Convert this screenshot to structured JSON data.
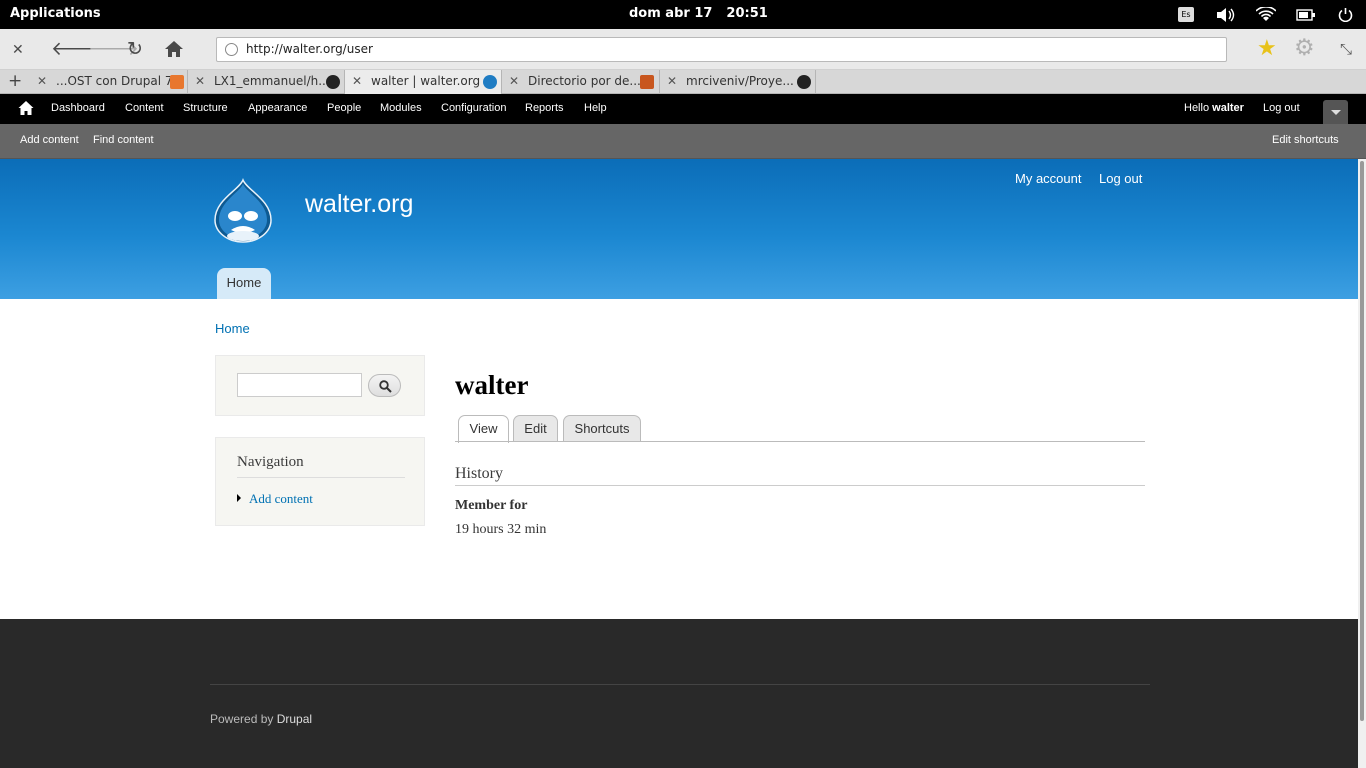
{
  "system": {
    "apps_label": "Applications",
    "date": "dom abr 17",
    "time": "20:51",
    "kbd_layout": "Es"
  },
  "browser": {
    "url": "http://walter.org/user",
    "tabs": [
      {
        "label": "...OST con Drupal 7",
        "favicon": "mozilla-icon"
      },
      {
        "label": "LX1_emmanuel/h...",
        "favicon": "github-icon"
      },
      {
        "label": "walter | walter.org",
        "favicon": "drupal-icon",
        "active": true
      },
      {
        "label": "Directorio por de...",
        "favicon": "folder-icon"
      },
      {
        "label": "mrciveniv/Proye...",
        "favicon": "github-icon"
      }
    ]
  },
  "admin": {
    "menu": [
      "Dashboard",
      "Content",
      "Structure",
      "Appearance",
      "People",
      "Modules",
      "Configuration",
      "Reports",
      "Help"
    ],
    "hello": "Hello",
    "user": "walter",
    "logout": "Log out"
  },
  "shortcuts": {
    "items": [
      "Add content",
      "Find content"
    ],
    "edit": "Edit shortcuts"
  },
  "header": {
    "site_name": "walter.org",
    "my_account": "My account",
    "logout": "Log out",
    "home_tab": "Home"
  },
  "breadcrumb": "Home",
  "sidebar": {
    "search_placeholder": "",
    "nav_title": "Navigation",
    "nav_items": [
      "Add content"
    ]
  },
  "page": {
    "title": "walter",
    "tabs": [
      "View",
      "Edit",
      "Shortcuts"
    ],
    "section": "History",
    "field_label": "Member for",
    "field_value": "19 hours 32 min"
  },
  "footer": {
    "powered": "Powered by",
    "drupal": "Drupal"
  }
}
